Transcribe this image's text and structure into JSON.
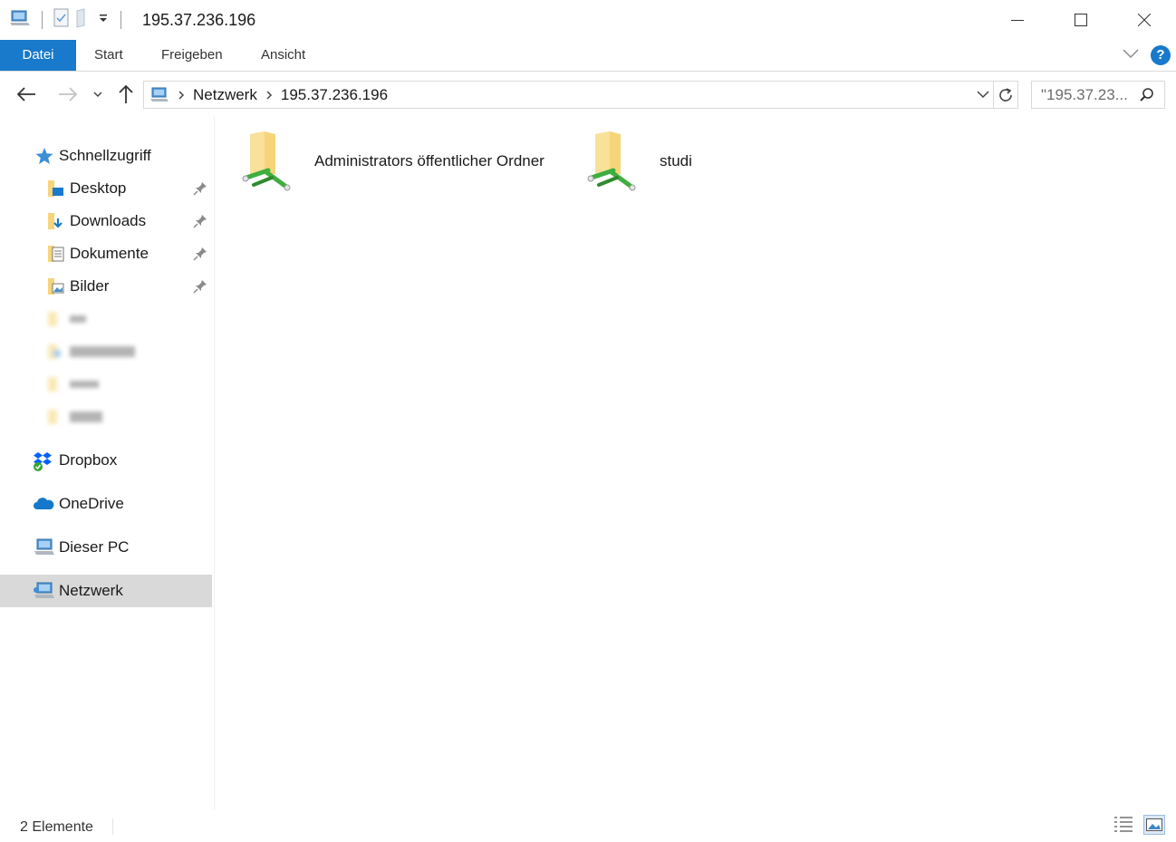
{
  "window": {
    "title": "195.37.236.196"
  },
  "ribbon": {
    "tabs": [
      {
        "label": "Datei"
      },
      {
        "label": "Start"
      },
      {
        "label": "Freigeben"
      },
      {
        "label": "Ansicht"
      }
    ],
    "help_label": "?"
  },
  "address": {
    "crumbs": [
      "Netzwerk",
      "195.37.236.196"
    ]
  },
  "search": {
    "value": "\"195.37.23..."
  },
  "navpane": {
    "quick_access": "Schnellzugriff",
    "pinned": [
      {
        "label": "Desktop",
        "icon": "desktop-folder-icon"
      },
      {
        "label": "Downloads",
        "icon": "downloads-folder-icon"
      },
      {
        "label": "Dokumente",
        "icon": "documents-folder-icon"
      },
      {
        "label": "Bilder",
        "icon": "pictures-folder-icon"
      }
    ],
    "dropbox": "Dropbox",
    "onedrive": "OneDrive",
    "this_pc": "Dieser PC",
    "network": "Netzwerk"
  },
  "content": {
    "shares": [
      {
        "label": "Administrators öffentlicher Ordner",
        "icon": "network-share-folder-icon"
      },
      {
        "label": "studi",
        "icon": "network-share-folder-icon"
      }
    ]
  },
  "statusbar": {
    "count": "2 Elemente"
  },
  "colors": {
    "accent": "#1979ca",
    "selected_bg": "#d9d9d9",
    "folder_yellow": "#f6d57a",
    "share_green": "#3fae3f"
  }
}
